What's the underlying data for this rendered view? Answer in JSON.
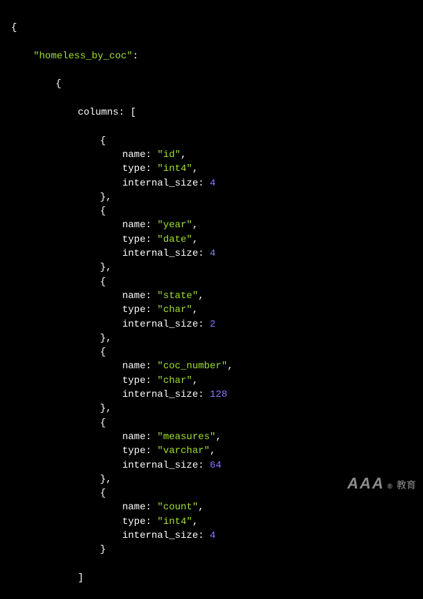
{
  "tableKey": "\"homeless_by_coc\"",
  "columnsLabel": "columns",
  "propNames": {
    "name": "name",
    "type": "type",
    "size": "internal_size"
  },
  "columns": [
    {
      "name": "\"id\"",
      "type": "\"int4\"",
      "internal_size": "4"
    },
    {
      "name": "\"year\"",
      "type": "\"date\"",
      "internal_size": "4"
    },
    {
      "name": "\"state\"",
      "type": "\"char\"",
      "internal_size": "2"
    },
    {
      "name": "\"coc_number\"",
      "type": "\"char\"",
      "internal_size": "128"
    },
    {
      "name": "\"measures\"",
      "type": "\"varchar\"",
      "internal_size": "64"
    },
    {
      "name": "\"count\"",
      "type": "\"int4\"",
      "internal_size": "4"
    }
  ],
  "watermark": {
    "text": "AAA",
    "cn": "教育"
  }
}
